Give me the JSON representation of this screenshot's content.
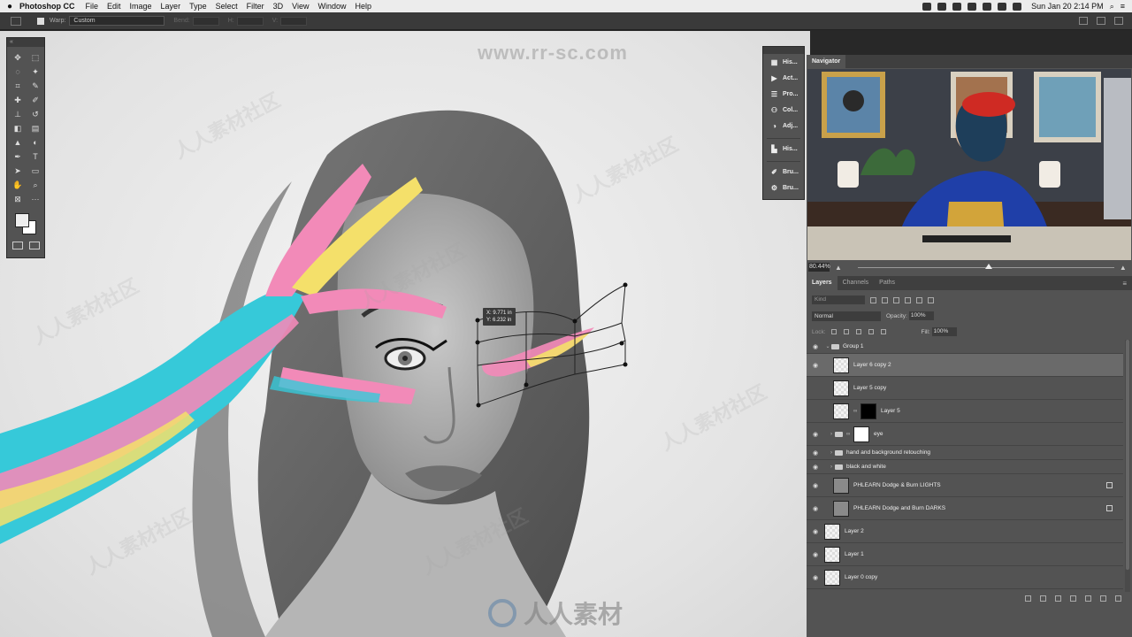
{
  "menubar": {
    "apple": "",
    "app": "Photoshop CC",
    "menus": [
      "File",
      "Edit",
      "Image",
      "Layer",
      "Type",
      "Select",
      "Filter",
      "3D",
      "View",
      "Window",
      "Help"
    ],
    "clock": "Sun Jan 20  2:14 PM"
  },
  "options": {
    "warp_label": "Warp:",
    "warp_value": "Custom",
    "bend_label": "Bend:",
    "h_label": "H:",
    "v_label": "V:"
  },
  "watermarks": {
    "url": "www.rr-sc.com",
    "logo": "人人素材",
    "tile": "人人素材社区"
  },
  "transform_tip": {
    "x": "X: 9.771 in",
    "y": "Y: 6.232 in"
  },
  "dock": {
    "items": [
      {
        "icon": "history-icon",
        "label": "His..."
      },
      {
        "icon": "actions-icon",
        "label": "Act..."
      },
      {
        "icon": "properties-icon",
        "label": "Pro..."
      },
      {
        "icon": "color-icon",
        "label": "Col..."
      },
      {
        "icon": "adjustments-icon",
        "label": "Adj..."
      },
      {
        "icon": "histogram-icon",
        "label": "His..."
      },
      {
        "icon": "brushes-icon",
        "label": "Bru..."
      },
      {
        "icon": "brush-settings-icon",
        "label": "Bru..."
      }
    ]
  },
  "navigator": {
    "tab": "Navigator",
    "zoom": "80.44%"
  },
  "layers_panel": {
    "tabs": [
      "Layers",
      "Channels",
      "Paths"
    ],
    "kind": "Kind",
    "blend": "Normal",
    "opacity_label": "Opacity:",
    "opacity": "100%",
    "lock_label": "Lock:",
    "fill_label": "Fill:",
    "fill": "100%",
    "layers": [
      {
        "name": "Group 1",
        "type": "group",
        "visible": true,
        "indent": 0
      },
      {
        "name": "Layer 6 copy 2",
        "type": "layer",
        "visible": true,
        "indent": 1,
        "selected": true
      },
      {
        "name": "Layer 5 copy",
        "type": "layer",
        "visible": false,
        "indent": 1
      },
      {
        "name": "Layer 5",
        "type": "masked",
        "visible": false,
        "indent": 1
      },
      {
        "name": "eye",
        "type": "group-masked",
        "visible": true,
        "indent": 1
      },
      {
        "name": "hand and background retouching",
        "type": "group",
        "visible": true,
        "indent": 1
      },
      {
        "name": "black and white",
        "type": "group",
        "visible": true,
        "indent": 1
      },
      {
        "name": "PHLEARN Dodge & Burn LIGHTS",
        "type": "smart",
        "visible": true,
        "indent": 1
      },
      {
        "name": "PHLEARN Dodge and Burn DARKS",
        "type": "smart",
        "visible": true,
        "indent": 1
      },
      {
        "name": "Layer 2",
        "type": "layer",
        "visible": true,
        "indent": 0
      },
      {
        "name": "Layer 1",
        "type": "layer",
        "visible": true,
        "indent": 0
      },
      {
        "name": "Layer 0 copy",
        "type": "layer",
        "visible": true,
        "indent": 0
      }
    ]
  }
}
